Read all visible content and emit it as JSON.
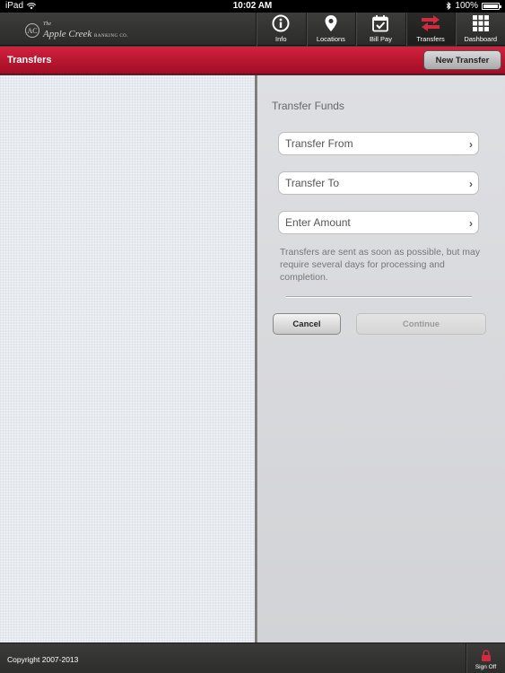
{
  "status_bar": {
    "device": "iPad",
    "time": "10:02 AM",
    "battery": "100%"
  },
  "brand": {
    "seal": "AC",
    "line1": "The",
    "name": "Apple Creek",
    "banking": "BANKING CO."
  },
  "nav": [
    {
      "label": "Info",
      "icon": "info-icon"
    },
    {
      "label": "Locations",
      "icon": "location-pin-icon"
    },
    {
      "label": "Bill Pay",
      "icon": "calendar-check-icon"
    },
    {
      "label": "Transfers",
      "icon": "transfer-arrows-icon",
      "active": true
    },
    {
      "label": "Dashboard",
      "icon": "grid-icon"
    }
  ],
  "title_bar": {
    "title": "Transfers",
    "new_transfer_label": "New Transfer"
  },
  "form": {
    "heading": "Transfer Funds",
    "transfer_from": "Transfer From",
    "transfer_to": "Transfer To",
    "enter_amount": "Enter Amount",
    "note": "Transfers are sent as soon as possible, but may require several days for processing and completion.",
    "cancel_label": "Cancel",
    "continue_label": "Continue"
  },
  "footer": {
    "copyright": "Copyright 2007-2013",
    "sign_off_label": "Sign Off"
  },
  "colors": {
    "accent_red": "#c0172f",
    "active_transfer_icon": "#d22a3e"
  }
}
